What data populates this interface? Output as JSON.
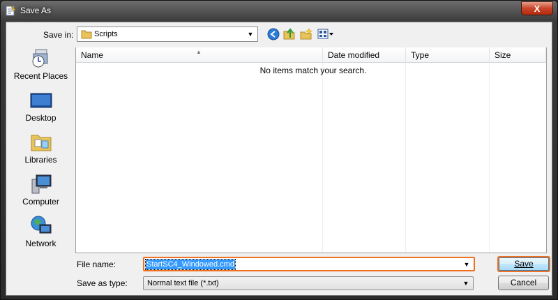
{
  "window": {
    "title": "Save As",
    "close_glyph": "X"
  },
  "toolbar": {
    "save_in_label": "Save in:",
    "save_in_value": "Scripts",
    "icons": [
      "back-icon",
      "up-folder-icon",
      "new-folder-icon",
      "view-menu-icon"
    ]
  },
  "places": [
    {
      "label": "Recent Places",
      "icon": "recent-places-icon"
    },
    {
      "label": "Desktop",
      "icon": "desktop-icon"
    },
    {
      "label": "Libraries",
      "icon": "libraries-icon"
    },
    {
      "label": "Computer",
      "icon": "computer-icon"
    },
    {
      "label": "Network",
      "icon": "network-icon"
    }
  ],
  "list": {
    "columns": [
      "Name",
      "Date modified",
      "Type",
      "Size"
    ],
    "empty_message": "No items match your search."
  },
  "form": {
    "file_name_label": "File name:",
    "file_name_value": "StartSC4_Windowed.cmd",
    "save_as_type_label": "Save as type:",
    "save_as_type_value": "Normal text file (*.txt)"
  },
  "buttons": {
    "save": "Save",
    "cancel": "Cancel"
  },
  "colors": {
    "highlight_outline": "#ef7020",
    "selection": "#3399ff"
  }
}
